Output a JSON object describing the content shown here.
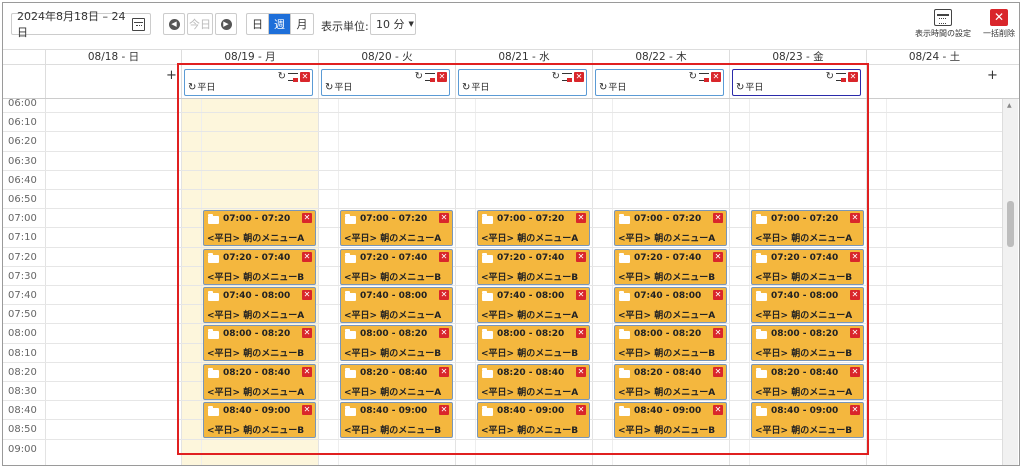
{
  "toolbar": {
    "date_range": "2024年8月18日 – 24日",
    "today_label": "今日",
    "prev_icon": "chevron-left-icon",
    "next_icon": "chevron-right-icon",
    "views": [
      "日",
      "週",
      "月"
    ],
    "active_view": "週",
    "unit_label": "表示単位:",
    "unit_value": "10 分",
    "display_settings_label": "表示時間の設定",
    "delete_all_label": "一括削除"
  },
  "days": [
    {
      "label": "08/18 - 日"
    },
    {
      "label": "08/19 - 月"
    },
    {
      "label": "08/20 - 火"
    },
    {
      "label": "08/21 - 水"
    },
    {
      "label": "08/22 - 木"
    },
    {
      "label": "08/23 - 金"
    },
    {
      "label": "08/24 - 土"
    }
  ],
  "allday_label": "平日",
  "time_labels": [
    "06:00",
    "06:10",
    "06:20",
    "06:30",
    "06:40",
    "06:50",
    "07:00",
    "07:10",
    "07:20",
    "07:30",
    "07:40",
    "07:50",
    "08:00",
    "08:10",
    "08:20",
    "08:30",
    "08:40",
    "08:50",
    "09:00"
  ],
  "events": [
    {
      "time": "07:00 - 07:20",
      "title": "<平日> 朝のメニューA"
    },
    {
      "time": "07:20 - 07:40",
      "title": "<平日> 朝のメニューB"
    },
    {
      "time": "07:40 - 08:00",
      "title": "<平日> 朝のメニューA"
    },
    {
      "time": "08:00 - 08:20",
      "title": "<平日> 朝のメニューB"
    },
    {
      "time": "08:20 - 08:40",
      "title": "<平日> 朝のメニューA"
    },
    {
      "time": "08:40 - 09:00",
      "title": "<平日> 朝のメニューB"
    }
  ],
  "colors": {
    "event_bg": "#f4b73e",
    "event_border": "#7a96b8",
    "today_bg": "#fdf6dc",
    "active_view": "#1e6fd9",
    "highlight": "#e02020",
    "delete": "#d9262b"
  }
}
